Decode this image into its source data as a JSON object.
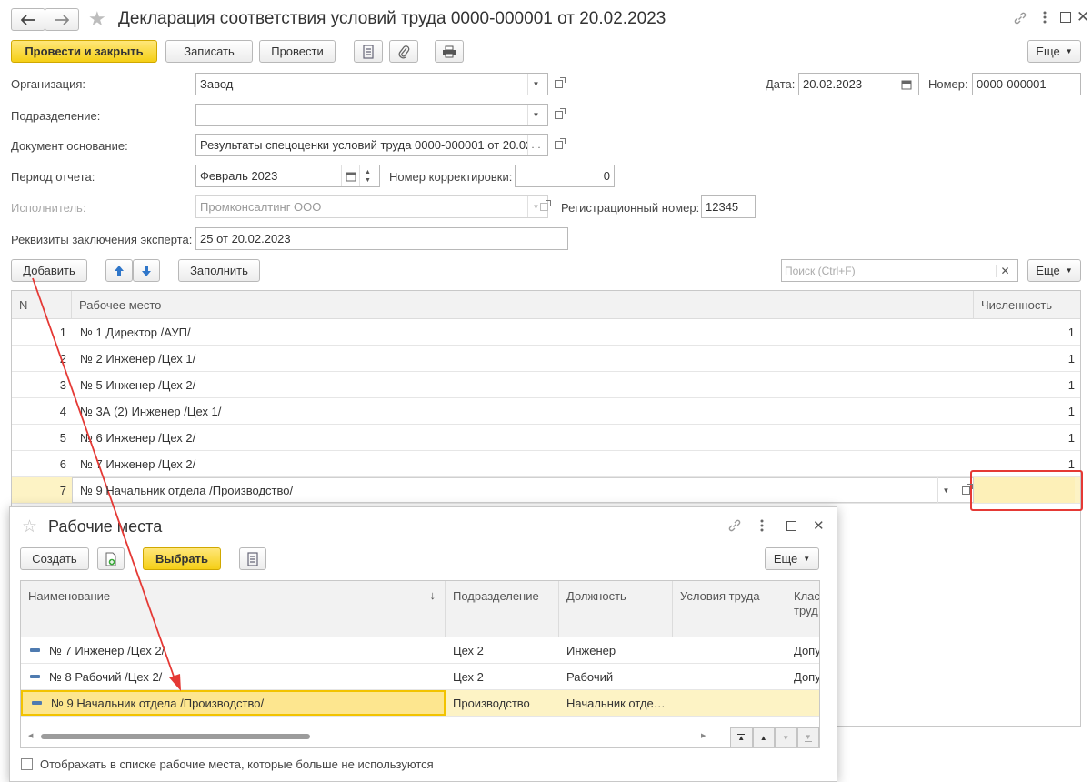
{
  "window": {
    "title": "Декларация соответствия условий труда 0000-000001 от 20.02.2023"
  },
  "toolbar": {
    "post_close": "Провести и закрыть",
    "save": "Записать",
    "post": "Провести",
    "more": "Еще"
  },
  "form": {
    "org_label": "Организация:",
    "org_value": "Завод",
    "date_label": "Дата:",
    "date_value": "20.02.2023",
    "number_label": "Номер:",
    "number_value": "0000-000001",
    "dept_label": "Подразделение:",
    "dept_value": "",
    "base_label": "Документ основание:",
    "base_value": "Результаты спецоценки условий труда 0000-000001 от 20.02",
    "period_label": "Период отчета:",
    "period_value": "Февраль 2023",
    "corr_label": "Номер корректировки:",
    "corr_value": "0",
    "executor_label": "Исполнитель:",
    "executor_value": "Промконсалтинг ООО",
    "reg_label": "Регистрационный номер:",
    "reg_value": "12345",
    "expert_label": "Реквизиты заключения эксперта:",
    "expert_value": "25 от 20.02.2023"
  },
  "table_toolbar": {
    "add": "Добавить",
    "fill": "Заполнить",
    "search_placeholder": "Поиск (Ctrl+F)",
    "more": "Еще"
  },
  "table": {
    "headers": {
      "n": "N",
      "workplace": "Рабочее место",
      "count": "Численность"
    },
    "rows": [
      {
        "n": "1",
        "workplace": "№ 1 Директор /АУП/",
        "count": "1"
      },
      {
        "n": "2",
        "workplace": "№ 2 Инженер /Цех 1/",
        "count": "1"
      },
      {
        "n": "3",
        "workplace": "№ 5 Инженер /Цех 2/",
        "count": "1"
      },
      {
        "n": "4",
        "workplace": "№ 3А (2) Инженер /Цех 1/",
        "count": "1"
      },
      {
        "n": "5",
        "workplace": "№ 6 Инженер /Цех 2/",
        "count": "1"
      },
      {
        "n": "6",
        "workplace": "№ 7 Инженер /Цех 2/",
        "count": "1"
      },
      {
        "n": "7",
        "workplace": "№ 9 Начальник отдела /Производство/",
        "count": ""
      }
    ]
  },
  "dialog": {
    "title": "Рабочие места",
    "create": "Создать",
    "select": "Выбрать",
    "more": "Еще",
    "headers": {
      "name": "Наименование",
      "dept": "Подразделение",
      "position": "Должность",
      "conditions": "Условия труда",
      "class_1": "Клас",
      "class_2": "труд"
    },
    "rows": [
      {
        "name": "№ 7 Инженер /Цех 2/",
        "dept": "Цех 2",
        "position": "Инженер",
        "conditions": "",
        "class": "Допу"
      },
      {
        "name": "№ 8 Рабочий /Цех 2/",
        "dept": "Цех 2",
        "position": "Рабочий",
        "conditions": "",
        "class": "Допу"
      },
      {
        "name": "№ 9 Начальник отдела /Производство/",
        "dept": "Производство",
        "position": "Начальник отде…",
        "conditions": "",
        "class": ""
      }
    ],
    "checkbox_label": "Отображать в списке рабочие места, которые больше не используются"
  },
  "colors": {
    "primary_button": "#f5cf16",
    "row_highlight": "#fdf3c5",
    "annotation": "#e53935"
  }
}
